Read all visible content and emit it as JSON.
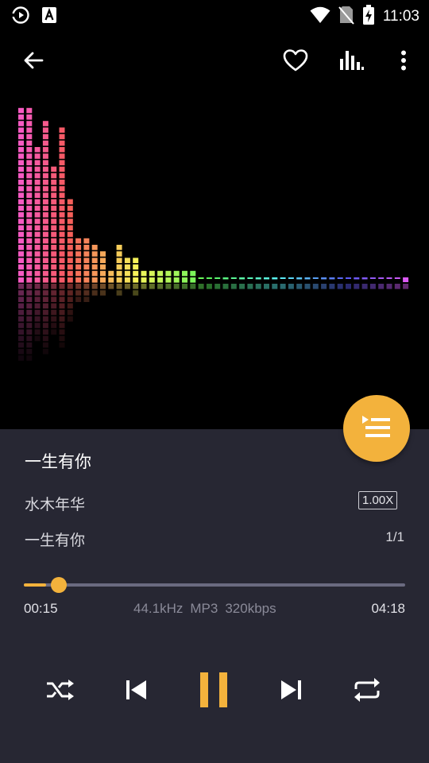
{
  "status_bar": {
    "time": "11:03",
    "left_icons": [
      "music-player-notification-icon",
      "a-badge-notification-icon"
    ],
    "right_icons": [
      "wifi-icon",
      "no-sim-icon",
      "battery-charging-icon"
    ]
  },
  "toolbar": {
    "icons": [
      "back-arrow-icon",
      "heart-icon",
      "equalizer-icon",
      "more-vert-icon"
    ]
  },
  "visualizer": {
    "levels": [
      0.9,
      0.92,
      0.7,
      0.84,
      0.62,
      0.81,
      0.46,
      0.24,
      0.24,
      0.2,
      0.18,
      0.08,
      0.2,
      0.14,
      0.16,
      0.09,
      0.07,
      0.07,
      0.07,
      0.07,
      0.07,
      0.07,
      0.007,
      0.006,
      0.006,
      0.01,
      0.007,
      0.01,
      0.007,
      0.01,
      0.01,
      0.01,
      0.007,
      0.007,
      0.01,
      0.01,
      0.007,
      0.01,
      0.01,
      0.007,
      0.007,
      0.01,
      0.01,
      0.007,
      0.007,
      0.007,
      0.007,
      0.03
    ]
  },
  "fab": {
    "icon": "playlist-icon",
    "color": "#F3B23C"
  },
  "track": {
    "title": "一生有你",
    "artist": "水木年华",
    "album": "一生有你",
    "speed": "1.00X",
    "count": "1/1"
  },
  "progress": {
    "current": "00:15",
    "total": "04:18",
    "fraction": 0.058,
    "sample_rate": "44.1kHz",
    "format": "MP3",
    "bitrate": "320kbps"
  },
  "controls": {
    "icons": [
      "shuffle-icon",
      "previous-icon",
      "pause-icon",
      "next-icon",
      "repeat-icon"
    ],
    "accent": "#F3B23C"
  }
}
